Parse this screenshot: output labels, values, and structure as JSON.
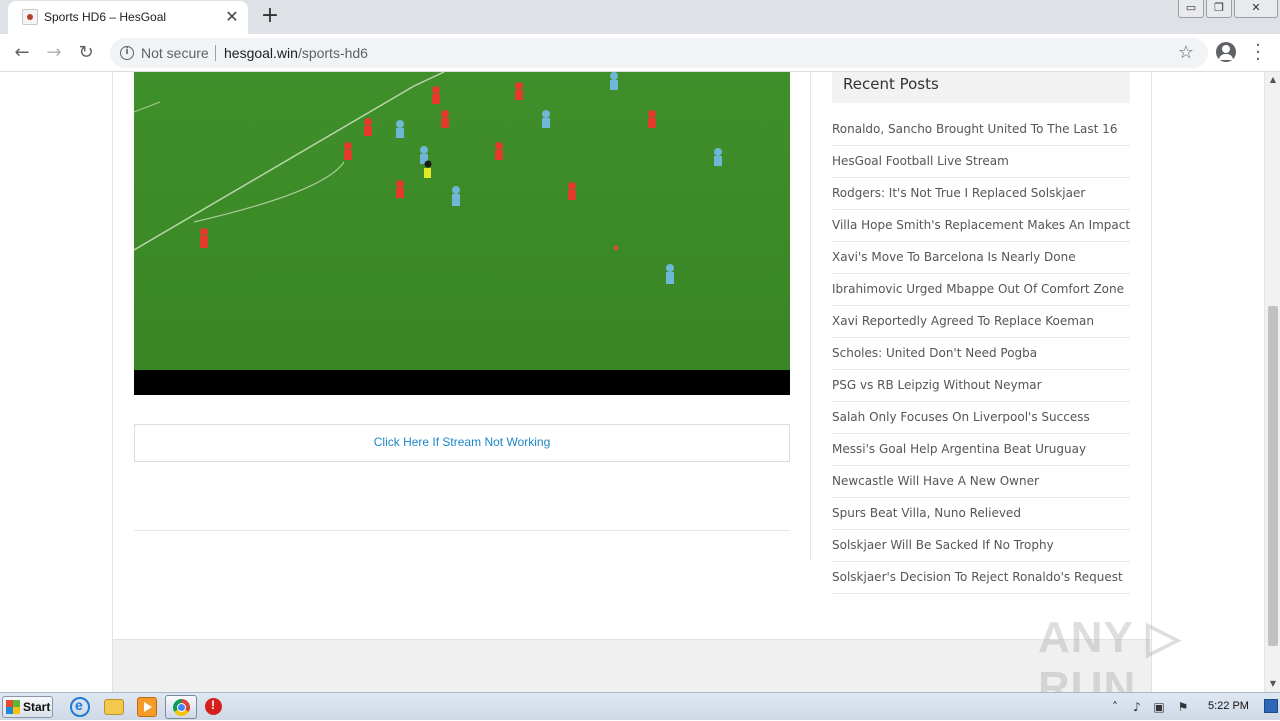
{
  "browser": {
    "tab_title": "Sports HD6 – HesGoal",
    "tab_close_glyph": "✕",
    "new_tab_glyph": "+",
    "window_controls": [
      "▭",
      "❐",
      "✕"
    ],
    "security_label": "Not secure",
    "url_host": "hesgoal.win",
    "url_path": "/sports-hd6"
  },
  "main": {
    "stream_link": "Click Here If Stream Not Working"
  },
  "sidebar": {
    "recent_title": "Recent Posts",
    "recent_posts": [
      "Ronaldo, Sancho Brought United To The Last 16",
      "HesGoal Football Live Stream",
      "Rodgers: It's Not True I Replaced Solskjaer",
      "Villa Hope Smith's Replacement Makes An Impact",
      "Xavi's Move To Barcelona Is Nearly Done",
      "Ibrahimovic Urged Mbappe Out Of Comfort Zone",
      "Xavi Reportedly Agreed To Replace Koeman",
      "Scholes: United Don't Need Pogba",
      "PSG vs RB Leipzig Without Neymar",
      "Salah Only Focuses On Liverpool's Success",
      "Messi's Goal Help Argentina Beat Uruguay",
      "Newcastle Will Have A New Owner",
      "Spurs Beat Villa, Nuno Relieved",
      "Solskjaer Will Be Sacked If No Trophy",
      "Solskjaer's Decision To Reject Ronaldo's Request"
    ]
  },
  "watermark": "ANY ▷ RUN",
  "taskbar": {
    "start_label": "Start",
    "clock": "5:22 PM"
  },
  "colors": {
    "link": "#1e86c8",
    "pitch": "#3c8a28",
    "home_kit": "#e23b2e",
    "away_kit": "#6fb7d6"
  },
  "icons": {
    "back": "arrow-left-icon",
    "forward": "arrow-right-icon",
    "reload": "reload-icon",
    "info": "info-icon",
    "bookmark": "star-icon",
    "profile": "account-icon",
    "menu": "kebab-menu-icon"
  }
}
